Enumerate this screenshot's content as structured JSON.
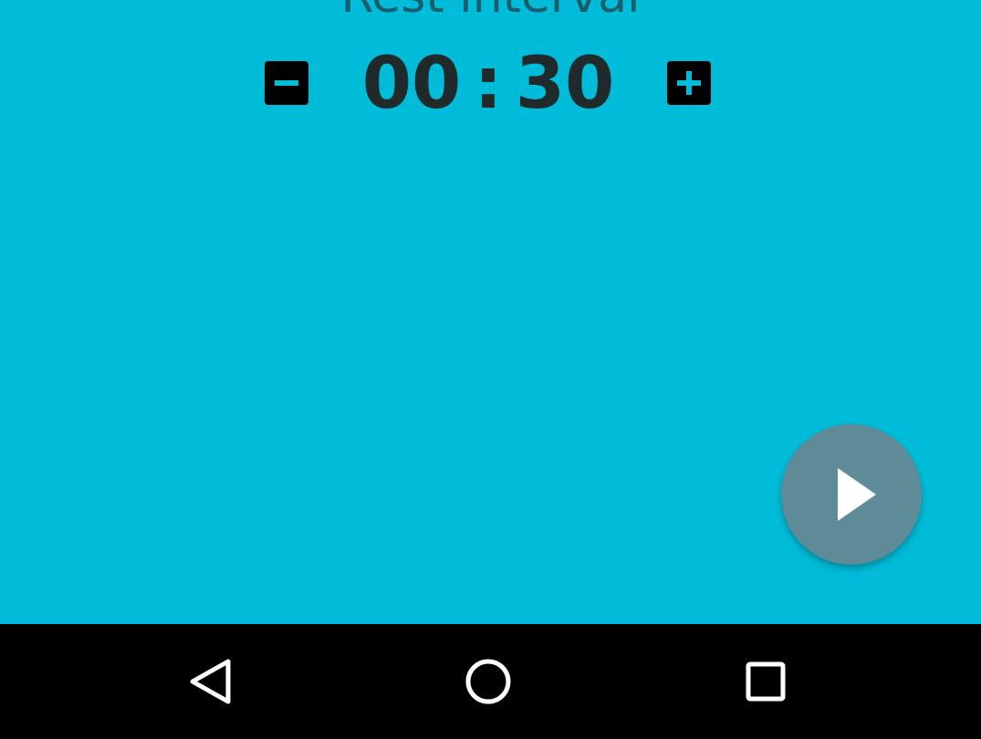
{
  "screen": {
    "title": "Rest interval"
  },
  "timer": {
    "minutes": "00",
    "separator": ":",
    "seconds": "30"
  },
  "controls": {
    "decrement_icon": "minus-box-icon",
    "increment_icon": "plus-box-icon",
    "play_icon": "play-icon"
  },
  "navbar": {
    "back_icon": "back-triangle-icon",
    "home_icon": "home-circle-icon",
    "recents_icon": "recents-square-icon"
  },
  "colors": {
    "background": "#00bcd8",
    "play_button": "#5e8b97",
    "navbar": "#000000",
    "timer_text": "#202a2b"
  }
}
